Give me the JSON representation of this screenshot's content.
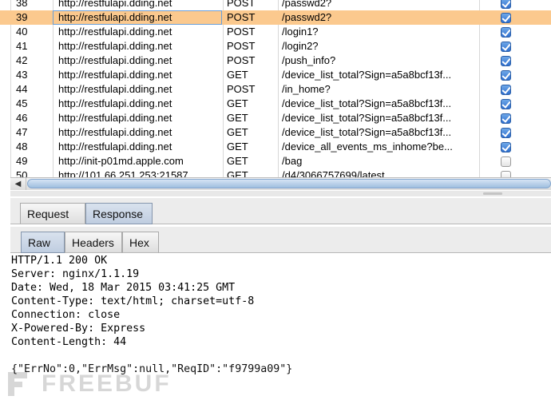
{
  "requests": [
    {
      "num": "38",
      "host": "http://restfulapi.dding.net",
      "method": "POST",
      "url": "/passwd2?",
      "checked": true
    },
    {
      "num": "39",
      "host": "http://restfulapi.dding.net",
      "method": "POST",
      "url": "/passwd2?",
      "checked": true,
      "selected": true
    },
    {
      "num": "40",
      "host": "http://restfulapi.dding.net",
      "method": "POST",
      "url": "/login1?",
      "checked": true
    },
    {
      "num": "41",
      "host": "http://restfulapi.dding.net",
      "method": "POST",
      "url": "/login2?",
      "checked": true
    },
    {
      "num": "42",
      "host": "http://restfulapi.dding.net",
      "method": "POST",
      "url": "/push_info?",
      "checked": true
    },
    {
      "num": "43",
      "host": "http://restfulapi.dding.net",
      "method": "GET",
      "url": "/device_list_total?Sign=a5a8bcf13f...",
      "checked": true
    },
    {
      "num": "44",
      "host": "http://restfulapi.dding.net",
      "method": "POST",
      "url": "/in_home?",
      "checked": true
    },
    {
      "num": "45",
      "host": "http://restfulapi.dding.net",
      "method": "GET",
      "url": "/device_list_total?Sign=a5a8bcf13f...",
      "checked": true
    },
    {
      "num": "46",
      "host": "http://restfulapi.dding.net",
      "method": "GET",
      "url": "/device_list_total?Sign=a5a8bcf13f...",
      "checked": true
    },
    {
      "num": "47",
      "host": "http://restfulapi.dding.net",
      "method": "GET",
      "url": "/device_list_total?Sign=a5a8bcf13f...",
      "checked": true
    },
    {
      "num": "48",
      "host": "http://restfulapi.dding.net",
      "method": "GET",
      "url": "/device_all_events_ms_inhome?be...",
      "checked": true
    },
    {
      "num": "49",
      "host": "http://init-p01md.apple.com",
      "method": "GET",
      "url": "/bag",
      "checked": false
    },
    {
      "num": "50",
      "host": "http://101.66.251.253:21587",
      "method": "GET",
      "url": "/d4/3066757699/latest",
      "checked": false
    }
  ],
  "main_tabs": [
    "Request",
    "Response"
  ],
  "main_tab_active": "Response",
  "sub_tabs": [
    "Raw",
    "Headers",
    "Hex"
  ],
  "sub_tab_active": "Raw",
  "response_lines": [
    "HTTP/1.1 200 OK",
    "Server: nginx/1.1.19",
    "Date: Wed, 18 Mar 2015 03:41:25 GMT",
    "Content-Type: text/html; charset=utf-8",
    "Connection: close",
    "X-Powered-By: Express",
    "Content-Length: 44",
    "",
    "{\"ErrNo\":0,\"ErrMsg\":null,\"ReqID\":\"f9799a09\"}"
  ],
  "watermark": "FREEBUF",
  "colors": {
    "selected_row": "#fbc98e",
    "active_tab": "#c9d5e6",
    "checkbox": "#2f6fce"
  },
  "icons": {
    "scroll_left": "left-arrow-icon",
    "checkbox_on": "checkbox-checked-icon",
    "checkbox_off": "checkbox-unchecked-icon"
  }
}
